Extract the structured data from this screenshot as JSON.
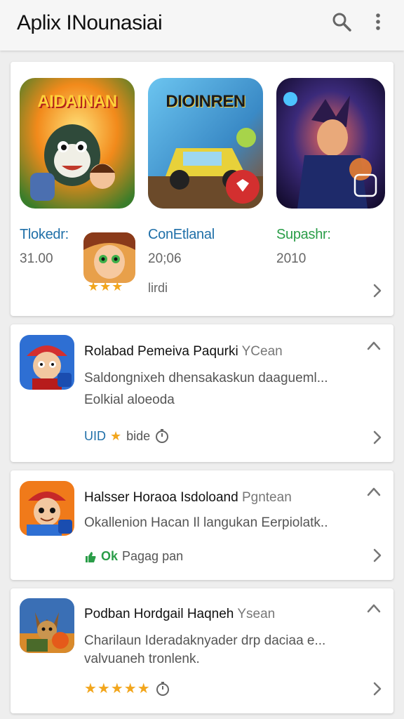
{
  "app_bar": {
    "title": "Aplix INounasiai",
    "search_icon": "search-icon",
    "menu_icon": "more-vert-icon"
  },
  "featured": {
    "tiles": [
      {
        "title": "AIDAINAN",
        "bg": "#f28a1b"
      },
      {
        "title": "DIOINREN",
        "bg": "#3a8ac6"
      },
      {
        "title": "",
        "bg": "#3b2a7a"
      }
    ],
    "items": [
      {
        "name": "Tlokedr:",
        "value": "31.00",
        "color": "#1f6fa8"
      },
      {
        "name": "ConEtlanal",
        "value": "20;06",
        "color": "#1f6fa8"
      },
      {
        "name": "Supashr:",
        "value": "2010",
        "color": "#2a9d48"
      }
    ],
    "extra": {
      "stars": "★★★",
      "label": "lirdi"
    }
  },
  "list": [
    {
      "title": "Rolabad Pemeiva Paqurki",
      "title_suffix": "YCean",
      "desc1": "Saldongnixeh dhensakaskun daagueml...",
      "desc2": "Eolkial aloeoda",
      "meta_text": "UID",
      "meta_after": "bide",
      "meta_color": "#1f6fa8"
    },
    {
      "title": "Halsser Horaoa Isdoloand",
      "title_suffix": "Pgntean",
      "desc1": "Okallenion Hacan Il langukan Eerpiolatk..",
      "desc2": "",
      "meta_text": "Ok",
      "meta_after": "Pagag pan",
      "meta_color": "#2a9d48"
    },
    {
      "title": "Podban Hordgail Haqneh",
      "title_suffix": "Ysean",
      "desc1": "Charilaun Ideradaknyader drp daciaa e...",
      "desc2": "valvuaneh tronlenk.",
      "meta_text": "★★★★★",
      "meta_after": "",
      "meta_color": "#f2a61d"
    }
  ]
}
